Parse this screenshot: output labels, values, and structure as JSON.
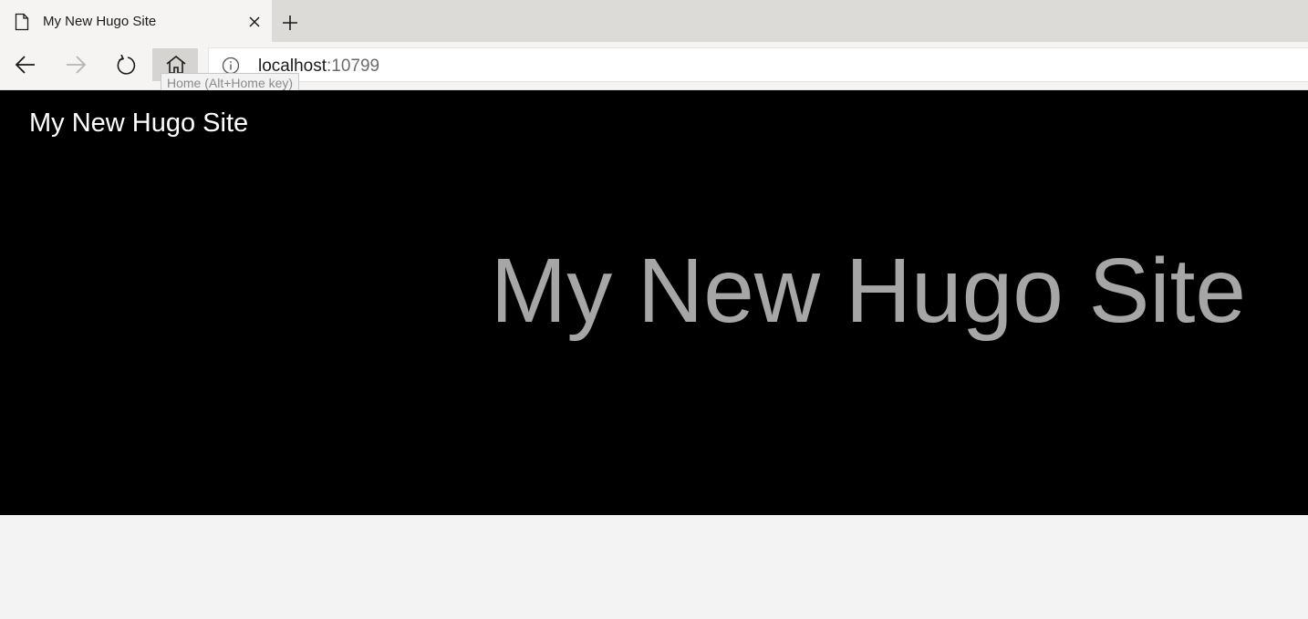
{
  "browser": {
    "tab": {
      "title": "My New Hugo Site",
      "icon": "page-icon"
    },
    "address": {
      "host": "localhost",
      "port": ":10799"
    },
    "tooltip": "Home (Alt+Home key)",
    "colors": {
      "chrome": "#dddbd8",
      "toolbar": "#f5f4f2",
      "hover": "#d6d4d1"
    }
  },
  "page": {
    "logo": "My New Hugo Site",
    "hero_title": "My New Hugo Site",
    "colors": {
      "hero_bg": "#000000",
      "logo": "#ffffff",
      "hero_text": "#a6a6a6",
      "body_bg": "#f3f3f3"
    }
  }
}
